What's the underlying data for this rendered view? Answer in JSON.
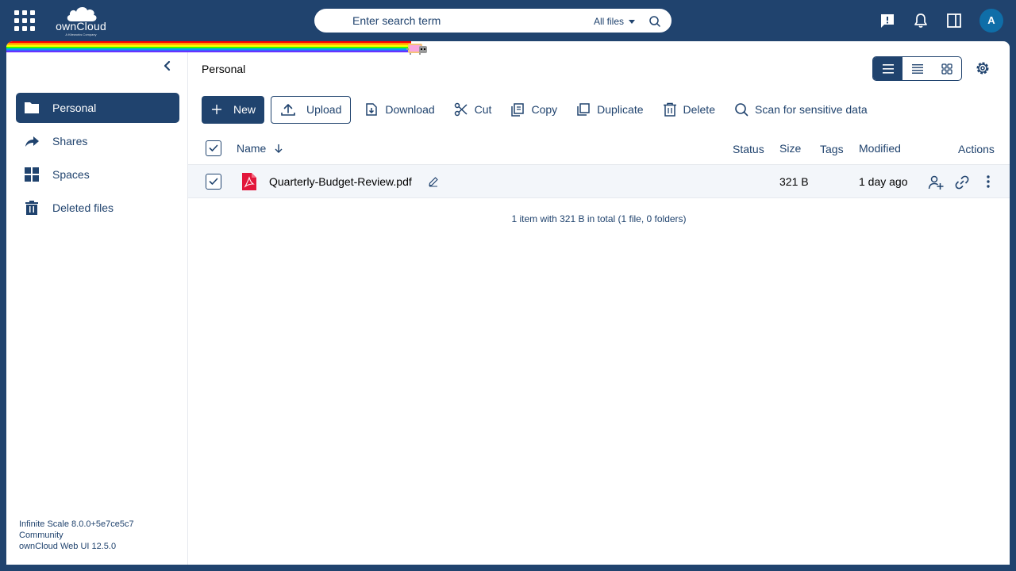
{
  "brand": {
    "name": "ownCloud",
    "tagline": "A Kiteworks Company"
  },
  "search": {
    "placeholder": "Enter search term",
    "scope": "All files"
  },
  "user": {
    "initial": "A"
  },
  "sidebar": {
    "items": [
      {
        "label": "Personal",
        "icon": "folder-icon",
        "active": true
      },
      {
        "label": "Shares",
        "icon": "share-icon"
      },
      {
        "label": "Spaces",
        "icon": "spaces-icon"
      },
      {
        "label": "Deleted files",
        "icon": "trash-icon"
      }
    ],
    "version": {
      "line1": "Infinite Scale 8.0.0+5e7ce5c7",
      "line2": "Community",
      "line3": "ownCloud Web UI 12.5.0"
    }
  },
  "breadcrumb": "Personal",
  "toolbar": {
    "new": "New",
    "upload": "Upload",
    "download": "Download",
    "cut": "Cut",
    "copy": "Copy",
    "duplicate": "Duplicate",
    "delete": "Delete",
    "scan": "Scan for sensitive data"
  },
  "table": {
    "columns": {
      "name": "Name",
      "status": "Status",
      "size": "Size",
      "tags": "Tags",
      "modified": "Modified",
      "actions": "Actions"
    },
    "rows": [
      {
        "name": "Quarterly-Budget-Review.pdf",
        "size": "321 B",
        "modified": "1 day ago",
        "selected": true
      }
    ],
    "summary": "1 item with 321 B in total (1 file, 0 folders)"
  },
  "colors": {
    "primary": "#20436e",
    "pdf": "#e2173b",
    "avatar": "#0f6ea8"
  }
}
